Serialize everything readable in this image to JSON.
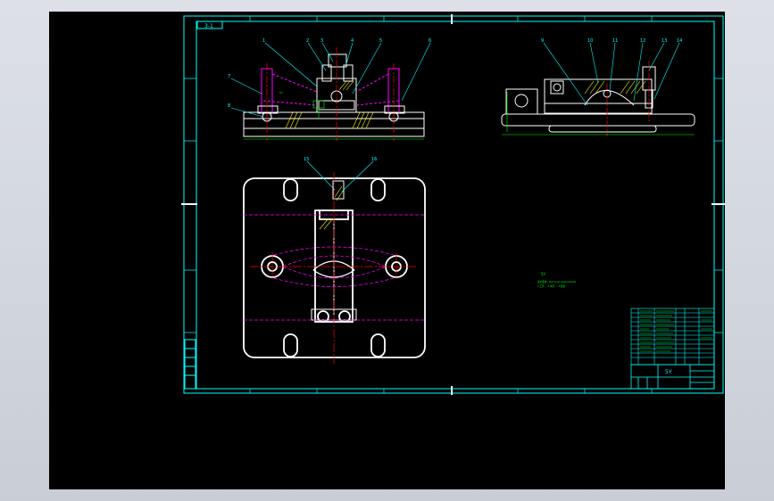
{
  "viewer": {
    "name": "CAD drawing viewer",
    "colors": {
      "chrome": "#d4d8de",
      "canvas": "#000000",
      "frame": "#00ffff",
      "geometry": "#ffffff",
      "centerline": "#ff0000",
      "hidden": "#ff00ff",
      "hatch": "#ffff00",
      "dimension": "#00ff00"
    }
  },
  "drawing": {
    "title_tag": "3-1",
    "part_mark": "5Y",
    "leader_tags_front": [
      "1",
      "2",
      "3",
      "4",
      "5",
      "6",
      "7",
      "8"
    ],
    "leader_tags_side": [
      "9",
      "10",
      "11",
      "12",
      "13",
      "14"
    ],
    "leader_tags_top": [
      "15",
      "16"
    ],
    "notes": {
      "heading": "5Y",
      "line1": "技术要求 / Technical requirements",
      "line2": "1.工件 ... 2.夹具 ... 3.装配 ..."
    },
    "title_block": {
      "drawing_name": "5Y"
    }
  }
}
